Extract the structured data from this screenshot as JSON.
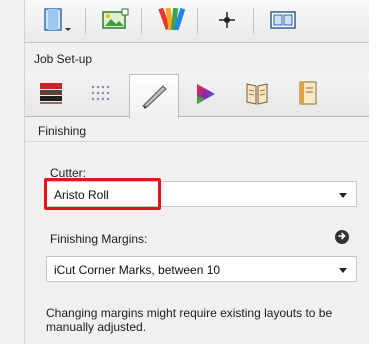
{
  "header": {
    "job_setup_label": "Job Set-up"
  },
  "toolbar": {
    "buttons": [
      {
        "icon": "document-dropdown-icon"
      },
      {
        "icon": "image-layout-icon"
      },
      {
        "icon": "color-swatches-icon"
      },
      {
        "icon": "crosshair-icon"
      },
      {
        "icon": "panels-icon"
      }
    ]
  },
  "tabs": [
    {
      "icon": "media-stack-icon"
    },
    {
      "icon": "grid-dots-icon"
    },
    {
      "icon": "finishing-knife-icon",
      "active": true
    },
    {
      "icon": "color-triangle-icon"
    },
    {
      "icon": "book-icon"
    },
    {
      "icon": "document-bookmark-icon"
    }
  ],
  "finishing": {
    "section_title": "Finishing",
    "cutter_label": "Cutter:",
    "cutter_value": "Aristo Roll",
    "margins_label": "Finishing Margins:",
    "margins_value": "iCut Corner Marks, between 10",
    "note": "Changing margins might require existing layouts to be manually adjusted."
  },
  "colors": {
    "highlight": "#e3151b",
    "panel_bg": "#f0f0f0"
  }
}
